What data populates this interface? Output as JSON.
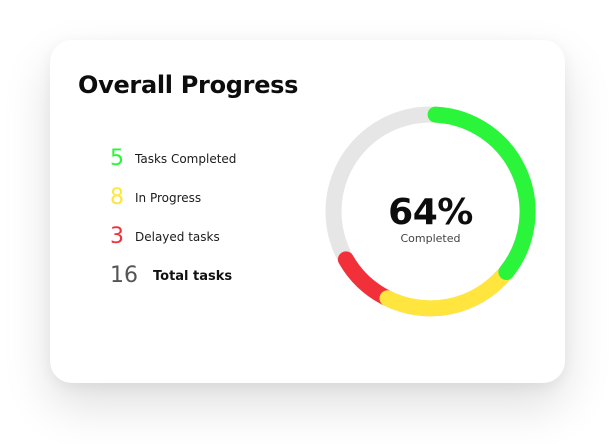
{
  "card": {
    "title": "Overall Progress"
  },
  "stats": [
    {
      "value": "5",
      "label": "Tasks Completed",
      "color": "#2bf53a"
    },
    {
      "value": "8",
      "label": "In Progress",
      "color": "#ffe53d"
    },
    {
      "value": "3",
      "label": "Delayed tasks",
      "color": "#f2303a"
    },
    {
      "value": "16",
      "label": "Total tasks",
      "color": "#555555"
    }
  ],
  "donut": {
    "percent": "64%",
    "percent_label": "Completed",
    "track_color": "#e6e6e6",
    "segments": [
      {
        "name": "completed",
        "color": "#2bf53a"
      },
      {
        "name": "in-progress",
        "color": "#ffe53d"
      },
      {
        "name": "delayed",
        "color": "#f2303a"
      }
    ]
  }
}
